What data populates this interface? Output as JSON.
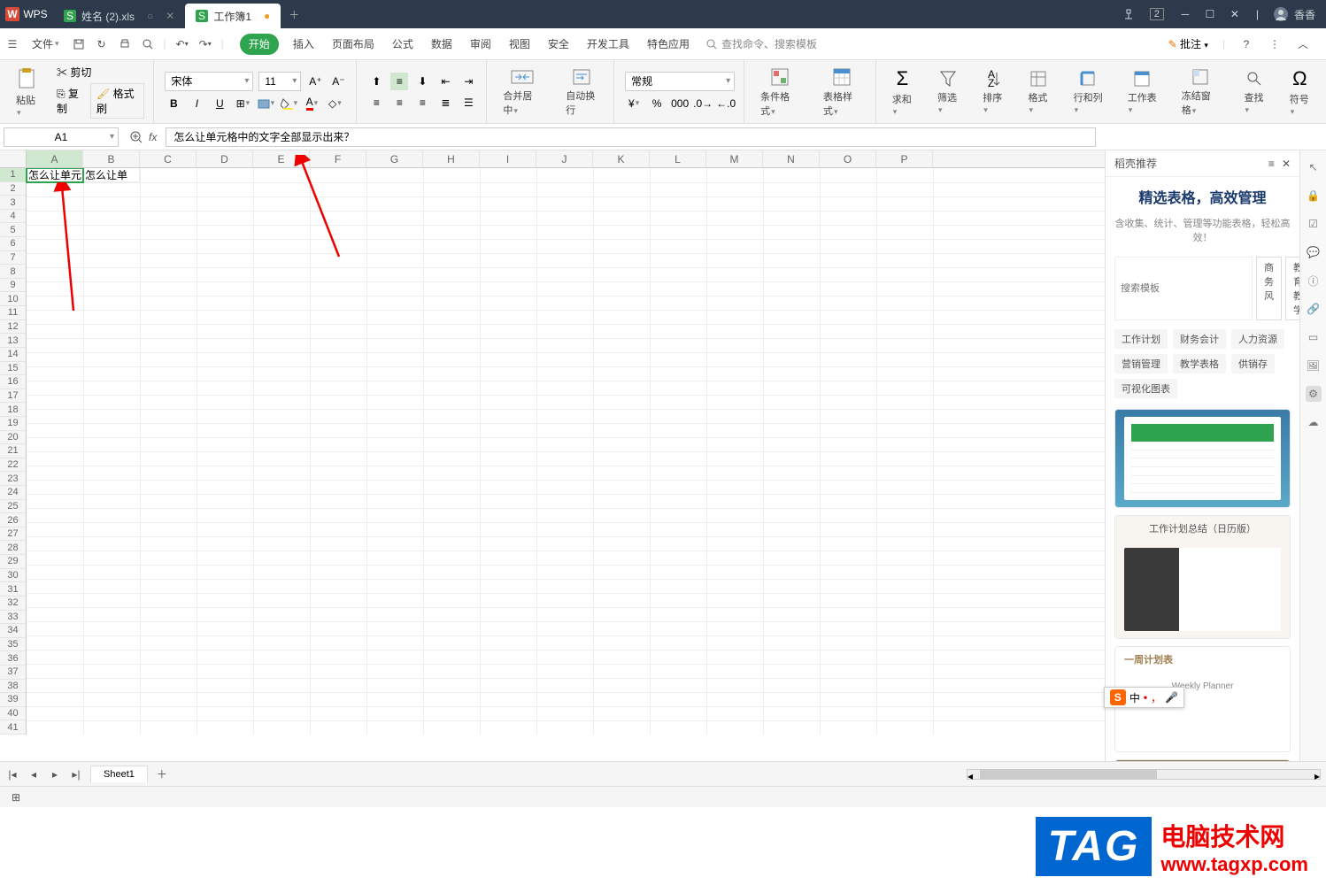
{
  "titlebar": {
    "logo": "WPS",
    "tabs": [
      {
        "icon": "xls",
        "label": "姓名 (2).xls",
        "active": false
      },
      {
        "icon": "xls",
        "label": "工作簿1",
        "active": true
      }
    ],
    "badge": "2",
    "user": "香香"
  },
  "menu": {
    "file": "文件",
    "items": [
      "开始",
      "插入",
      "页面布局",
      "公式",
      "数据",
      "审阅",
      "视图",
      "安全",
      "开发工具",
      "特色应用"
    ],
    "active_index": 0,
    "search_placeholder": "查找命令、搜索模板",
    "annotate": "批注"
  },
  "ribbon": {
    "paste": "粘贴",
    "cut": "剪切",
    "copy": "复制",
    "painter": "格式刷",
    "font_name": "宋体",
    "font_size": "11",
    "merge": "合并居中",
    "wrap": "自动换行",
    "numfmt": "常规",
    "cond": "条件格式",
    "tblstyle": "表格样式",
    "sum": "求和",
    "filter": "筛选",
    "sort": "排序",
    "format": "格式",
    "rowcol": "行和列",
    "worksheet": "工作表",
    "freeze": "冻结窗格",
    "find": "查找",
    "symbol": "符号"
  },
  "namebox": "A1",
  "formula": "怎么让单元格中的文字全部显示出来？",
  "columns": [
    "A",
    "B",
    "C",
    "D",
    "E",
    "F",
    "G",
    "H",
    "I",
    "J",
    "K",
    "L",
    "M",
    "N",
    "O",
    "P"
  ],
  "rows": [
    "1",
    "2",
    "3",
    "4",
    "5",
    "6",
    "7",
    "8",
    "9",
    "10",
    "11",
    "12",
    "13",
    "14",
    "15",
    "16",
    "17",
    "18",
    "19",
    "20",
    "21",
    "22",
    "23",
    "24",
    "25",
    "26",
    "27",
    "28",
    "29",
    "30",
    "31",
    "32",
    "33",
    "34",
    "35",
    "36",
    "37",
    "38",
    "39",
    "40",
    "41"
  ],
  "cells": {
    "A1": "怎么让单元",
    "B1": "怎么让单"
  },
  "sheet_tab": "Sheet1",
  "side": {
    "header": "稻壳推荐",
    "title": "精选表格，高效管理",
    "subtitle": "含收集、统计、管理等功能表格，轻松高效！",
    "search_ph": "搜索模板",
    "btn1": "商务风",
    "btn2": "教育教学",
    "tags": [
      "工作计划",
      "财务会计",
      "人力资源",
      "营销管理",
      "教学表格",
      "供销存",
      "可视化图表"
    ],
    "tpl2_title": "工作计划总结（日历版）",
    "tpl3_sub": "Weekly Planner",
    "tpl3_title": "一周计划表"
  },
  "ime": {
    "ch": "中"
  },
  "watermark": {
    "logo": "TAG",
    "cn": "电脑技术网",
    "url": "www.tagxp.com"
  }
}
